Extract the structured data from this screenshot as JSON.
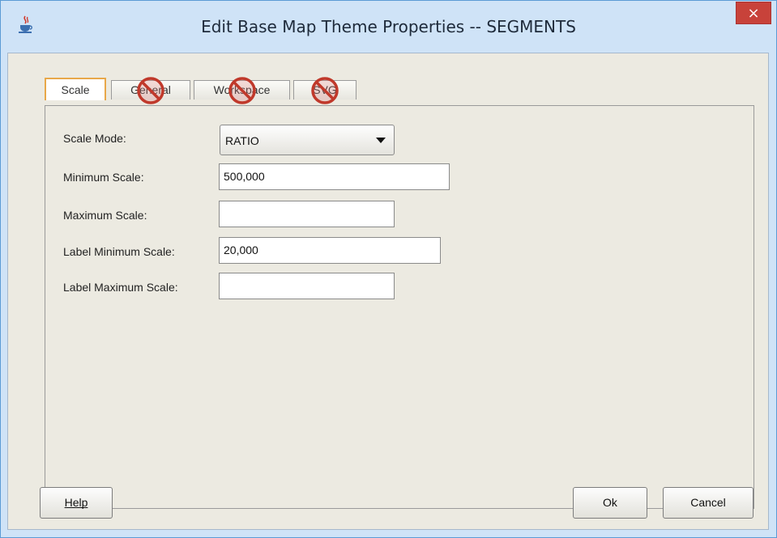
{
  "window": {
    "title": "Edit Base Map Theme Properties -- SEGMENTS",
    "close_label": "×"
  },
  "tabs": [
    {
      "label": "Scale",
      "active": true,
      "disabled": false
    },
    {
      "label": "General",
      "active": false,
      "disabled": true
    },
    {
      "label": "Workspace",
      "active": false,
      "disabled": true
    },
    {
      "label": "SVG",
      "active": false,
      "disabled": true
    }
  ],
  "form": {
    "scale_mode_label": "Scale Mode:",
    "scale_mode_value": "RATIO",
    "min_scale_label": "Minimum Scale:",
    "min_scale_value": "500,000",
    "max_scale_label": "Maximum Scale:",
    "max_scale_value": "",
    "label_min_scale_label": "Label Minimum Scale:",
    "label_min_scale_value": "20,000",
    "label_max_scale_label": "Label Maximum Scale:",
    "label_max_scale_value": ""
  },
  "buttons": {
    "help": "Help",
    "ok": "Ok",
    "cancel": "Cancel"
  },
  "colors": {
    "title_bg": "#cfe3f7",
    "close_bg": "#c8423a",
    "active_tab_border": "#e8a84a",
    "disabled_overlay": "#c0392b"
  }
}
